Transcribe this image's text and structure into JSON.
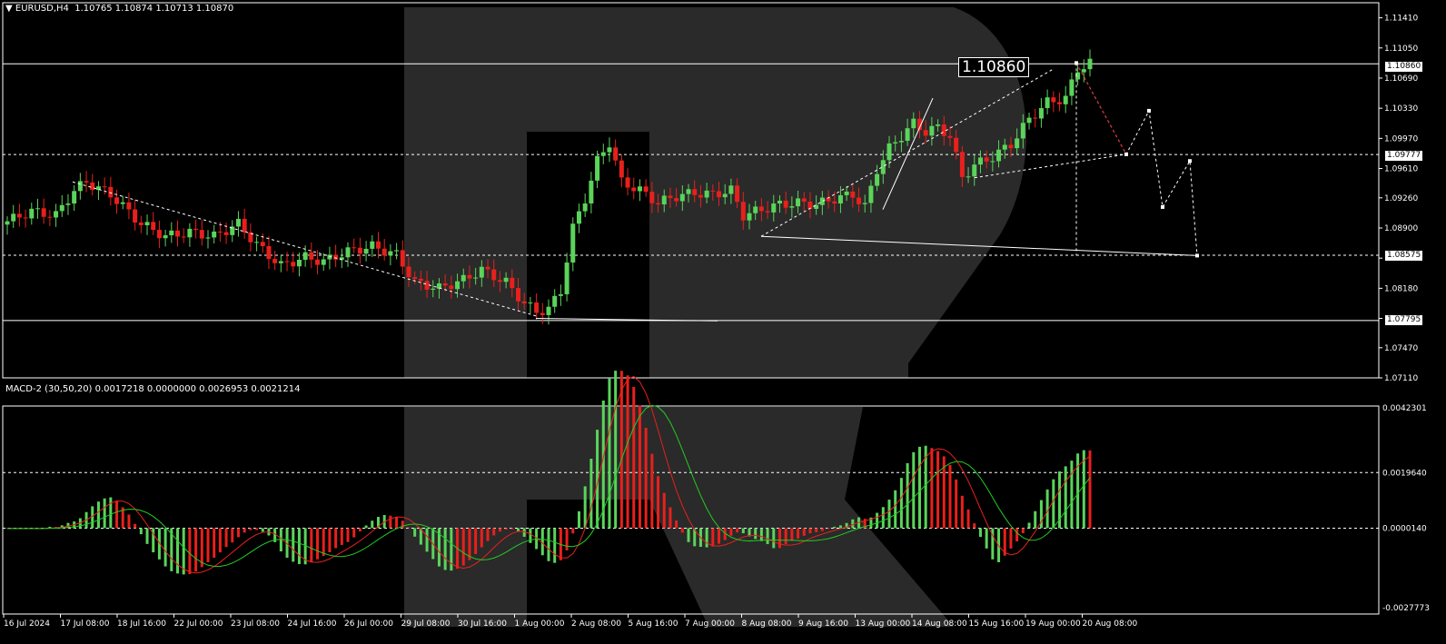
{
  "header": {
    "symbol": "EURUSD,H4",
    "ohlc": "1.10765 1.10874 1.10713 1.10870",
    "indicator": "MACD-2 (30,50,20) 0.0017218 0.0000000 0.0026953 0.0021214"
  },
  "colors": {
    "bull": "#5ad45a",
    "bear": "#e8201c",
    "macd_main": "#e8201c",
    "macd_signal": "#22cc22",
    "grid": "#ffffff",
    "watermark": "#2a2a2a"
  },
  "price_axis": {
    "ticks": [
      "1.11410",
      "1.11050",
      "1.10690",
      "1.10330",
      "1.09970",
      "1.09610",
      "1.09260",
      "1.08900",
      "1.08540",
      "1.08180",
      "1.07820",
      "1.07470",
      "1.07110"
    ],
    "ylim": [
      1.0711,
      1.1159
    ]
  },
  "levels": {
    "current": "1.10860",
    "big_label": "1.10860",
    "support_1": "1.09777",
    "support_2": "1.08575",
    "support_3": "1.07795"
  },
  "macd_axis": {
    "ticks": [
      "0.0042301",
      "0.0019640",
      "0.0000140",
      "-0.0027773"
    ]
  },
  "time_axis": {
    "labels": [
      "16 Jul 2024",
      "17 Jul 08:00",
      "18 Jul 16:00",
      "22 Jul 00:00",
      "23 Jul 08:00",
      "24 Jul 16:00",
      "26 Jul 00:00",
      "29 Jul 08:00",
      "30 Jul 16:00",
      "1 Aug 00:00",
      "2 Aug 08:00",
      "5 Aug 16:00",
      "7 Aug 00:00",
      "8 Aug 08:00",
      "9 Aug 16:00",
      "13 Aug 00:00",
      "14 Aug 08:00",
      "15 Aug 16:00",
      "19 Aug 00:00",
      "20 Aug 08:00"
    ]
  },
  "chart_data": {
    "type": "candlestick",
    "title": "EURUSD,H4",
    "ylim": [
      1.0711,
      1.1159
    ],
    "anchors": [
      [
        0,
        1.0898
      ],
      [
        4,
        1.091
      ],
      [
        8,
        1.0905
      ],
      [
        11,
        1.0935
      ],
      [
        13,
        1.0945
      ],
      [
        17,
        1.093
      ],
      [
        22,
        1.0895
      ],
      [
        26,
        1.088
      ],
      [
        30,
        1.0885
      ],
      [
        34,
        1.088
      ],
      [
        38,
        1.0895
      ],
      [
        41,
        1.087
      ],
      [
        45,
        1.0845
      ],
      [
        49,
        1.0855
      ],
      [
        52,
        1.085
      ],
      [
        56,
        1.0862
      ],
      [
        60,
        1.0868
      ],
      [
        64,
        1.0858
      ],
      [
        67,
        1.0825
      ],
      [
        71,
        1.0818
      ],
      [
        75,
        1.0828
      ],
      [
        78,
        1.084
      ],
      [
        82,
        1.0825
      ],
      [
        85,
        1.08
      ],
      [
        87,
        1.079
      ],
      [
        89,
        1.0793
      ],
      [
        91,
        1.0815
      ],
      [
        93,
        1.089
      ],
      [
        95,
        1.0925
      ],
      [
        97,
        1.097
      ],
      [
        99,
        1.0992
      ],
      [
        101,
        1.0945
      ],
      [
        104,
        1.0935
      ],
      [
        107,
        1.092
      ],
      [
        110,
        1.0928
      ],
      [
        113,
        1.0932
      ],
      [
        116,
        1.093
      ],
      [
        119,
        1.0935
      ],
      [
        121,
        1.0905
      ],
      [
        124,
        1.0912
      ],
      [
        127,
        1.0918
      ],
      [
        130,
        1.092
      ],
      [
        133,
        1.0918
      ],
      [
        136,
        1.0925
      ],
      [
        139,
        1.093
      ],
      [
        141,
        1.0915
      ],
      [
        143,
        1.096
      ],
      [
        145,
        1.0985
      ],
      [
        147,
        1.1
      ],
      [
        149,
        1.1015
      ],
      [
        151,
        1.1005
      ],
      [
        153,
        1.101
      ],
      [
        155,
        1.1
      ],
      [
        157,
        1.095
      ],
      [
        159,
        1.0965
      ],
      [
        162,
        1.0975
      ],
      [
        165,
        1.099
      ],
      [
        168,
        1.102
      ],
      [
        171,
        1.104
      ],
      [
        174,
        1.1045
      ],
      [
        176,
        1.108
      ],
      [
        178,
        1.1087
      ]
    ],
    "macd_ylim": [
      -0.003,
      0.0043
    ]
  }
}
